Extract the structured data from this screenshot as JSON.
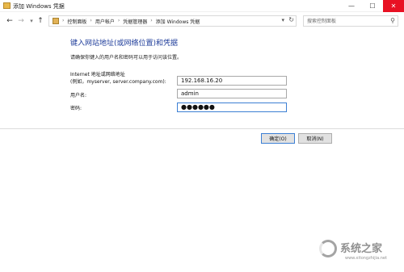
{
  "window": {
    "title": "添加 Windows 凭据",
    "controls": {
      "minimize": "—",
      "maximize": "☐",
      "close": "✕"
    }
  },
  "nav": {
    "back_icon": "←",
    "forward_icon": "→",
    "dropdown_icon": "▾",
    "up_icon": "↑",
    "breadcrumbs": [
      "控制面板",
      "用户帐户",
      "凭据管理器",
      "添加 Windows 凭据"
    ],
    "separator": "›",
    "address_dropdown": "▾",
    "refresh": "↻"
  },
  "search": {
    "placeholder": "搜索控制面板",
    "icon": "⚲"
  },
  "form": {
    "heading": "键入网站地址(或网络位置)和凭据",
    "subtitle": "请确保你键入的用户名和密码可以用于访问该位置。",
    "address_label_line1": "Internet 地址或网络地址",
    "address_label_line2": "(例如，myserver, server.company.com):",
    "address_value": "192.168.16.20",
    "username_label": "用户名:",
    "username_value": "admin",
    "password_label": "密码:",
    "password_value": "●●●●●●"
  },
  "buttons": {
    "ok": "确定(O)",
    "cancel": "取消(N)"
  },
  "watermark": {
    "text": "系统之家",
    "url": "www.xitongzhijia.net"
  }
}
